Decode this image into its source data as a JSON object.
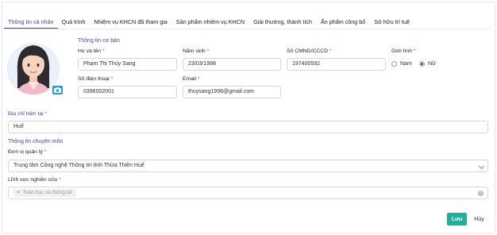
{
  "tabs": [
    {
      "label": "Thông tin cá nhân",
      "active": true
    },
    {
      "label": "Quá trình"
    },
    {
      "label": "Nhiệm vụ KHCN đã tham gia"
    },
    {
      "label": "Sản phẩm nhiệm vụ KHCN"
    },
    {
      "label": "Giải thưởng, thành tích"
    },
    {
      "label": "Ấn phẩm công bố"
    },
    {
      "label": "Sở hữu trí tuệ"
    }
  ],
  "basic": {
    "title": "Thông tin cơ bản",
    "full_name_label": "Họ và tên",
    "full_name_value": "Phạm Thị Thùy Sang",
    "dob_label": "Năm sinh",
    "dob_value": "23/03/1998",
    "id_label": "Số CMND/CCCD",
    "id_value": "197400592",
    "gender_label": "Giới tính",
    "gender_male": "Nam",
    "gender_female": "Nữ",
    "gender_selected": "Nữ",
    "phone_label": "Số điện thoại",
    "phone_value": "0396002001",
    "email_label": "Email",
    "email_value": "thuysang1998@gmail.com"
  },
  "address": {
    "label": "Địa chỉ hiện tại",
    "value": "Huế"
  },
  "professional": {
    "title": "Thông tin chuyên môn",
    "unit_label": "Đơn vị quản lý",
    "unit_value": "Trung tâm Công nghệ Thông tin tỉnh Thừa Thiên Huế",
    "field_label": "Lĩnh vực nghiên cứu",
    "field_chip": "Toán học và thống kê"
  },
  "required_mark": "*",
  "actions": {
    "save": "Lưu",
    "cancel": "Hủy"
  },
  "colors": {
    "accent": "#3d4bb0",
    "save_button": "#20b09a",
    "required": "#e53935",
    "camera": "#1f9fd6"
  },
  "icons": {
    "camera": "camera-icon",
    "chevron": "chevron-down-icon",
    "chip_remove": "close-icon",
    "clear": "clear-icon"
  }
}
